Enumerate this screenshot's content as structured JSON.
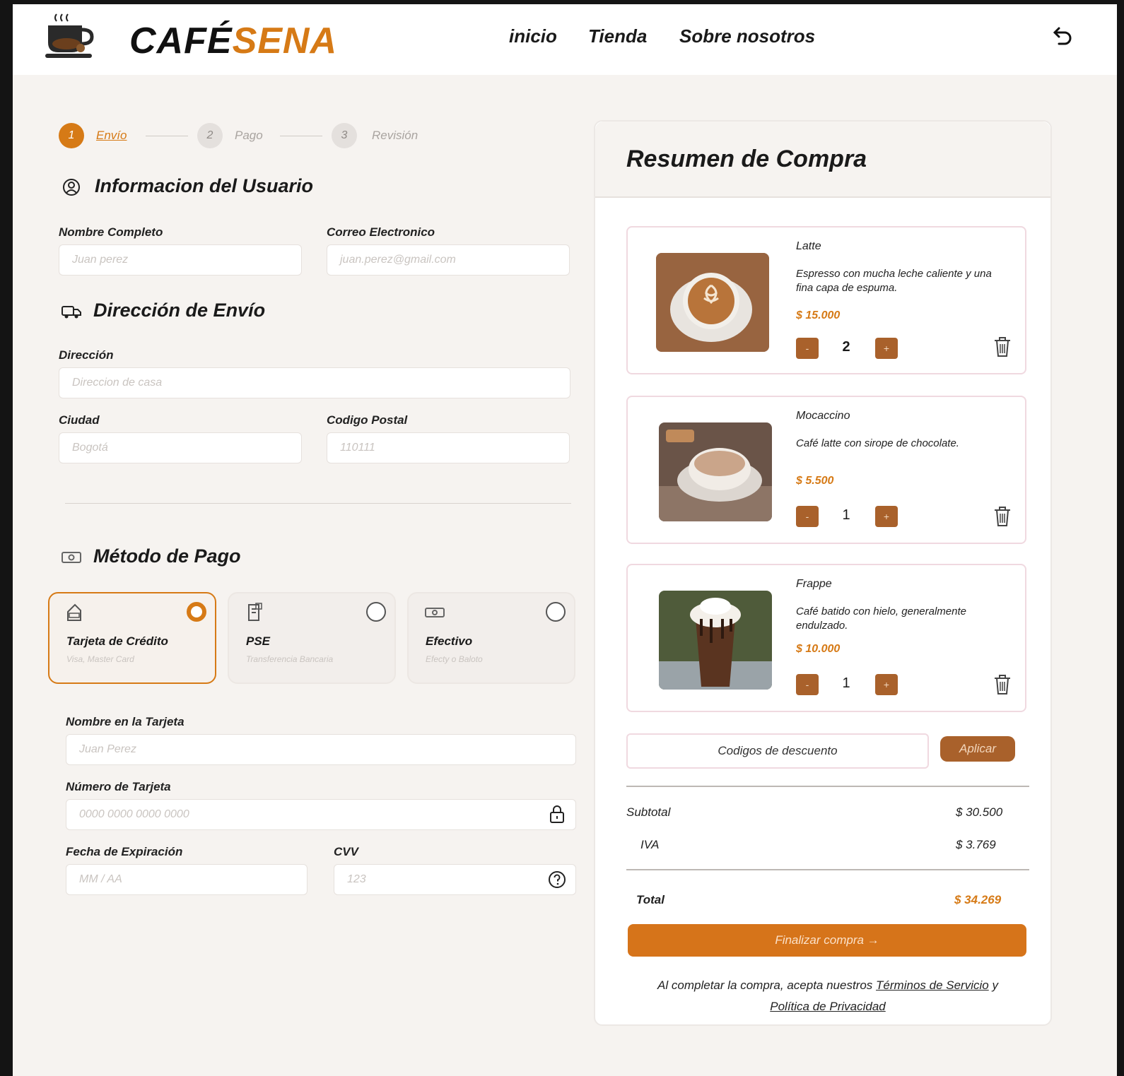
{
  "header": {
    "brand_part1": "CAFÉ",
    "brand_part2": "SENA",
    "nav": [
      "inicio",
      "Tienda",
      "Sobre nosotros"
    ]
  },
  "steps": [
    {
      "num": "1",
      "label": "Envío"
    },
    {
      "num": "2",
      "label": "Pago"
    },
    {
      "num": "3",
      "label": "Revisión"
    }
  ],
  "user_info": {
    "title": "Informacion del Usuario",
    "name_label": "Nombre Completo",
    "name_placeholder": "Juan perez",
    "email_label": "Correo Electronico",
    "email_placeholder": "juan.perez@gmail.com"
  },
  "shipping": {
    "title": "Dirección de Envío",
    "address_label": "Dirección",
    "address_placeholder": "Direccion de casa",
    "city_label": "Ciudad",
    "city_placeholder": "Bogotá",
    "zip_label": "Codigo Postal",
    "zip_placeholder": "110111"
  },
  "payment": {
    "title": "Método de Pago",
    "methods": [
      {
        "title": "Tarjeta de Crédito",
        "sub": "Visa, Master Card",
        "selected": true
      },
      {
        "title": "PSE",
        "sub": "Transferencia Bancaria",
        "selected": false
      },
      {
        "title": "Efectivo",
        "sub": "Efecty o Baloto",
        "selected": false
      }
    ],
    "card_name_label": "Nombre en la Tarjeta",
    "card_name_placeholder": "Juan Perez",
    "card_number_label": "Número de Tarjeta",
    "card_number_placeholder": "0000 0000 0000 0000",
    "expiry_label": "Fecha de Expiración",
    "expiry_placeholder": "MM / AA",
    "cvv_label": "CVV",
    "cvv_placeholder": "123"
  },
  "summary": {
    "title": "Resumen de Compra",
    "items": [
      {
        "name": "Latte",
        "desc": "Espresso con mucha leche caliente y una fina capa de espuma.",
        "price": "$ 15.000",
        "qty": "2"
      },
      {
        "name": "Mocaccino",
        "desc": "Café latte con sirope de chocolate.",
        "price": "$ 5.500",
        "qty": "1"
      },
      {
        "name": "Frappe",
        "desc": "Café batido con hielo, generalmente endulzado.",
        "price": "$ 10.000",
        "qty": "1"
      }
    ],
    "discount_label": "Codigos de descuento",
    "apply_label": "Aplicar",
    "subtotal_label": "Subtotal",
    "subtotal_value": "$ 30.500",
    "iva_label": "IVA",
    "iva_value": "$ 3.769",
    "total_label": "Total",
    "total_value": "$ 34.269",
    "checkout_label": "Finalizar compra →",
    "terms_prefix": "Al completar la compra, acepta nuestros",
    "terms_link": "Términos de Servicio",
    "terms_and": "y",
    "privacy_link": "Política de Privacidad",
    "minus": "-",
    "plus": "+"
  },
  "colors": {
    "accent": "#d67a16",
    "brown": "#a9612b",
    "background": "#f6f3f0"
  }
}
